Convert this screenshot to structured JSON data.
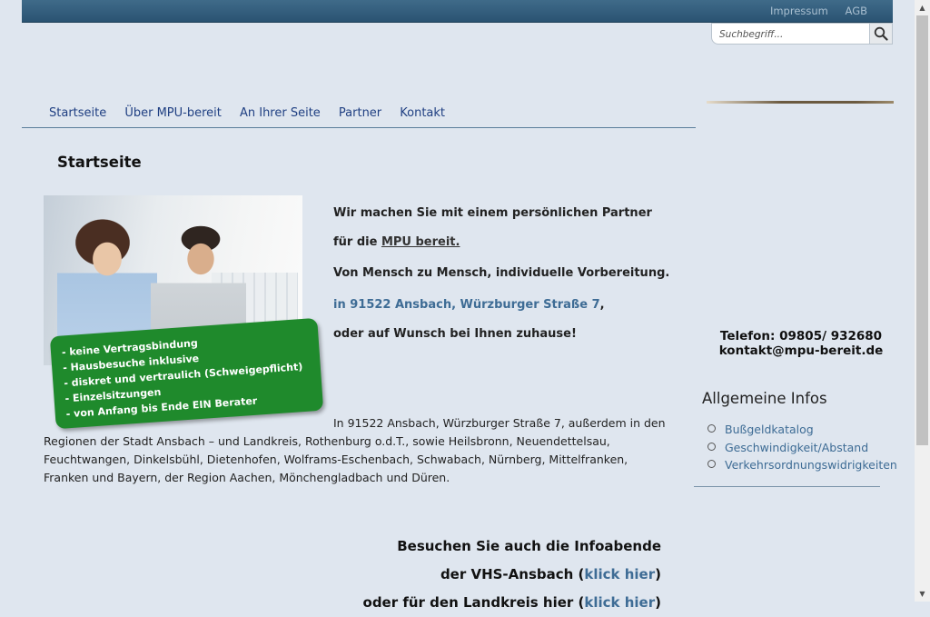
{
  "top_links": [
    "Impressum",
    "AGB"
  ],
  "search": {
    "placeholder": "Suchbegriff..."
  },
  "nav": [
    "Startseite",
    "Über MPU-bereit",
    "An Ihrer Seite",
    "Partner",
    "Kontakt"
  ],
  "page_title": "Startseite",
  "hero_bullets": [
    "- keine Vertragsbindung",
    "- Hausbesuche inklusive",
    "- diskret und vertraulich (Schweigepflicht)",
    "- Einzelsitzungen",
    "- von Anfang bis Ende EIN Berater"
  ],
  "intro": {
    "line1": "Wir machen Sie mit einem persönlichen Partner",
    "line2_prefix": "für die ",
    "line2_link": "MPU bereit.",
    "line3": "Von Mensch zu Mensch, individuelle Vorbereitung.",
    "address": "in 91522 Ansbach, Würzburger Straße 7",
    "address_suffix": ",",
    "line5": "oder auf Wunsch bei Ihnen zuhause!"
  },
  "body_text": {
    "first": "In 91522 Ansbach, Würzburger Straße 7, außerdem in den",
    "rest": "Regionen der Stadt Ansbach – und Landkreis, Rothenburg o.d.T., sowie Heilsbronn, Neuendettelsau, Feuchtwangen, Dinkelsbühl, Dietenhofen, Wolframs-Eschenbach, Schwabach, Nürnberg, Mittelfranken, Franken und Bayern, der Region Aachen, Mönchengladbach und Düren."
  },
  "vhs": {
    "line1": "Besuchen Sie auch die Infoabende",
    "line2_prefix": "der VHS-Ansbach (",
    "line2_link": "klick hier",
    "line2_suffix": ")",
    "line3_prefix": "oder für den Landkreis hier (",
    "line3_link": "klick hier",
    "line3_suffix": ")"
  },
  "contact": {
    "phone": "Telefon: 09805/ 932680",
    "email": "kontakt@mpu-bereit.de"
  },
  "infos": {
    "title": "Allgemeine Infos",
    "items": [
      "Bußgeldkatalog",
      "Geschwindigkeit/Abstand",
      "Verkehrsordnungswidrigkeiten"
    ]
  },
  "colors": {
    "background": "#dfe6ef",
    "topbar": "#2f5878",
    "nav_link": "#1f3f82",
    "accent_link": "#3e6c95",
    "badge_green": "#1f8a2c"
  }
}
